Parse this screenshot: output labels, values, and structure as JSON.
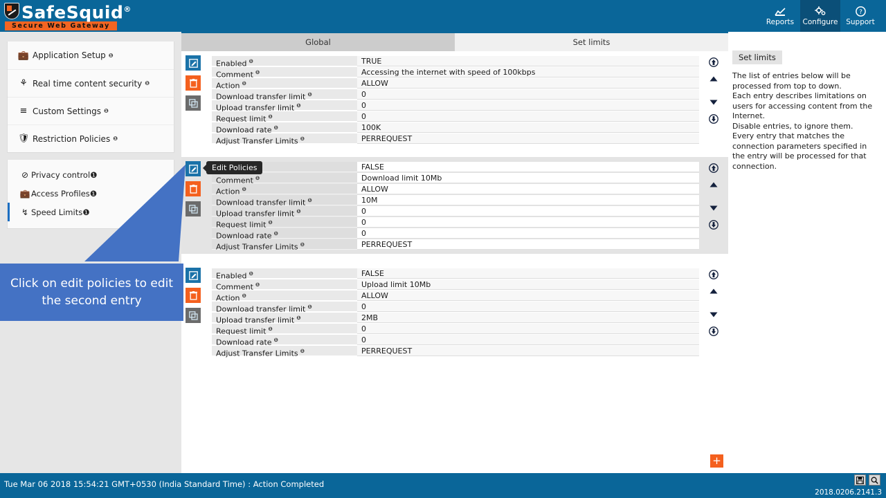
{
  "header": {
    "brand": "SafeSquid",
    "brand_reg": "®",
    "tagline": "Secure Web Gateway",
    "nav": [
      {
        "label": "Reports",
        "icon": "chart-icon",
        "active": false
      },
      {
        "label": "Configure",
        "icon": "gears-icon",
        "active": true
      },
      {
        "label": "Support",
        "icon": "help-circle-icon",
        "active": false
      }
    ]
  },
  "sidebar": {
    "groups": [
      {
        "label": "Application Setup",
        "icon": "briefcase-icon",
        "help": "❶"
      },
      {
        "label": "Real time content security",
        "icon": "shield-bug-icon",
        "help": "❶"
      },
      {
        "label": "Custom Settings",
        "icon": "sliders-icon",
        "help": "❶"
      },
      {
        "label": "Restriction Policies",
        "icon": "shield-icon",
        "help": "❶"
      }
    ],
    "sub_items": [
      {
        "label": "Privacy control",
        "icon": "no-entry-icon",
        "selected": false
      },
      {
        "label": "Access Profiles",
        "icon": "briefcase-icon",
        "selected": false
      },
      {
        "label": "Speed Limits",
        "icon": "speed-icon",
        "selected": true
      }
    ]
  },
  "tabs": [
    {
      "label": "Global",
      "active": true
    },
    {
      "label": "Set limits",
      "active": false
    }
  ],
  "help_panel": {
    "badge": "Set limits",
    "body": "The list of entries below will be processed from top to down.\nEach entry describes limitations on users for accessing content from the Internet.\nDisable entries, to ignore them.\nEvery entry that matches the connection parameters specified in the entry will be processed for that connection."
  },
  "field_labels": [
    "Enabled",
    "Comment",
    "Action",
    "Download transfer limit",
    "Upload transfer limit",
    "Request limit",
    "Download rate",
    "Adjust Transfer Limits"
  ],
  "entries": [
    {
      "values": [
        "TRUE",
        "Accessing the internet with speed of 100kbps",
        "ALLOW",
        "0",
        "0",
        "0",
        "100K",
        "PERREQUEST"
      ]
    },
    {
      "values": [
        "FALSE",
        "Download limit 10Mb",
        "ALLOW",
        "10M",
        "0",
        "0",
        "0",
        "PERREQUEST"
      ]
    },
    {
      "values": [
        "FALSE",
        "Upload limit 10Mb",
        "ALLOW",
        "0",
        "2MB",
        "0",
        "0",
        "PERREQUEST"
      ]
    }
  ],
  "entry_tools": [
    {
      "name": "edit-policies-button",
      "title": "Edit Policies"
    },
    {
      "name": "delete-entry-button",
      "title": "Delete"
    },
    {
      "name": "copy-entry-button",
      "title": "Copy"
    }
  ],
  "move_buttons": [
    {
      "name": "move-to-top-button"
    },
    {
      "name": "move-up-button"
    },
    {
      "name": "move-down-button"
    },
    {
      "name": "move-to-bottom-button"
    }
  ],
  "tooltip": {
    "text": "Edit Policies"
  },
  "callout": {
    "text": "Click on edit policies to edit the second entry"
  },
  "add_button": {
    "label": "+"
  },
  "footer": {
    "status": "Tue Mar 06 2018 15:54:21 GMT+0530 (India Standard Time) : Action Completed",
    "version": "2018.0206.2141.3",
    "icons": [
      {
        "name": "save-icon"
      },
      {
        "name": "search-icon"
      }
    ]
  },
  "colors": {
    "header_blue": "#0a6699",
    "accent_orange": "#f4601e",
    "edit_blue": "#1a72a8",
    "callout_blue": "#4472c4",
    "active_tab": "#cccccc"
  }
}
